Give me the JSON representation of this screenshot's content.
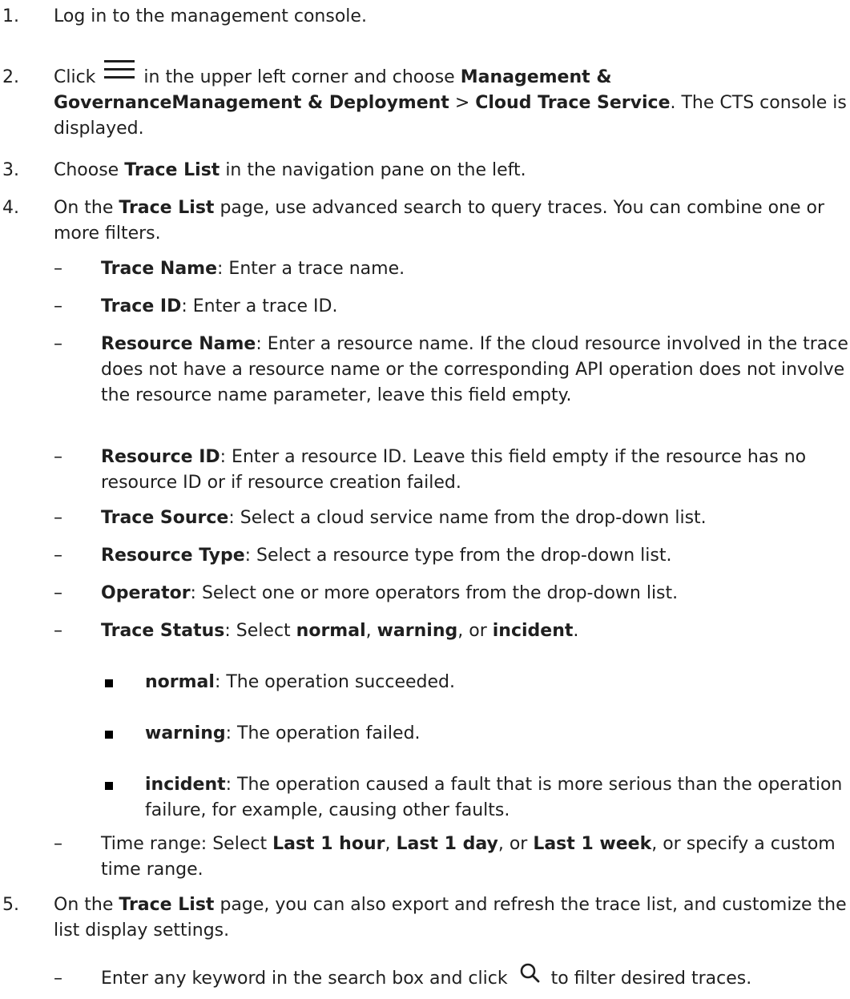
{
  "steps": [
    {
      "num": "1.",
      "text": "Log in to the management console."
    },
    {
      "num": "2.",
      "pre": "Click",
      "mid": "in the upper left corner and choose",
      "b1": "Management & GovernanceManagement & Deployment",
      "sep": ">",
      "b2": "Cloud Trace Service",
      "post": ". The CTS console is displayed."
    },
    {
      "num": "3.",
      "pre": "Choose",
      "b1": "Trace List",
      "post": "in the navigation pane on the left."
    },
    {
      "num": "4.",
      "pre": "On the",
      "b1": "Trace List",
      "post": "page, use advanced search to query traces. You can combine one or more filters."
    },
    {
      "num": "5.",
      "pre": "On the",
      "b1": "Trace List",
      "post": "page, you can also export and refresh the trace list, and customize the list display settings."
    }
  ],
  "filters": [
    {
      "bullet": "–",
      "label": "Trace Name",
      "desc": ": Enter a trace name."
    },
    {
      "bullet": "–",
      "label": "Trace ID",
      "desc": ": Enter a trace ID."
    },
    {
      "bullet": "–",
      "label": "Resource Name",
      "desc": ": Enter a resource name. If the cloud resource involved in the trace does not have a resource name or the corresponding API operation does not involve the resource name parameter, leave this field empty."
    },
    {
      "bullet": "–",
      "label": "Resource ID",
      "desc": ": Enter a resource ID. Leave this field empty if the resource has no resource ID or if resource creation failed."
    },
    {
      "bullet": "–",
      "label": "Trace Source",
      "desc": ": Select a cloud service name from the drop-down list."
    },
    {
      "bullet": "–",
      "label": "Resource Type",
      "desc": ": Select a resource type from the drop-down list."
    },
    {
      "bullet": "–",
      "label": "Operator",
      "desc": ": Select one or more operators from the drop-down list."
    },
    {
      "bullet": "–",
      "label": "Trace Status",
      "desc": ": Select ",
      "o1": "normal",
      "c1": ", ",
      "o2": "warning",
      "c2": ", or ",
      "o3": "incident",
      "end": "."
    }
  ],
  "statuses": [
    {
      "label": "normal",
      "desc": ": The operation succeeded."
    },
    {
      "label": "warning",
      "desc": ": The operation failed."
    },
    {
      "label": "incident",
      "desc": ": The operation caused a fault that is more serious than the operation failure, for example, causing other faults."
    }
  ],
  "time_range": {
    "bullet": "–",
    "pre": "Time range: Select ",
    "o1": "Last 1 hour",
    "c1": ", ",
    "o2": "Last 1 day",
    "c2": ", or ",
    "o3": "Last 1 week",
    "post": ", or specify a custom time range."
  },
  "step5_sub": {
    "bullet": "–",
    "pre": "Enter any keyword in the search box and click",
    "post": "to filter desired traces."
  },
  "icons": {
    "menu": "hamburger-menu-icon",
    "search": "search-icon"
  }
}
